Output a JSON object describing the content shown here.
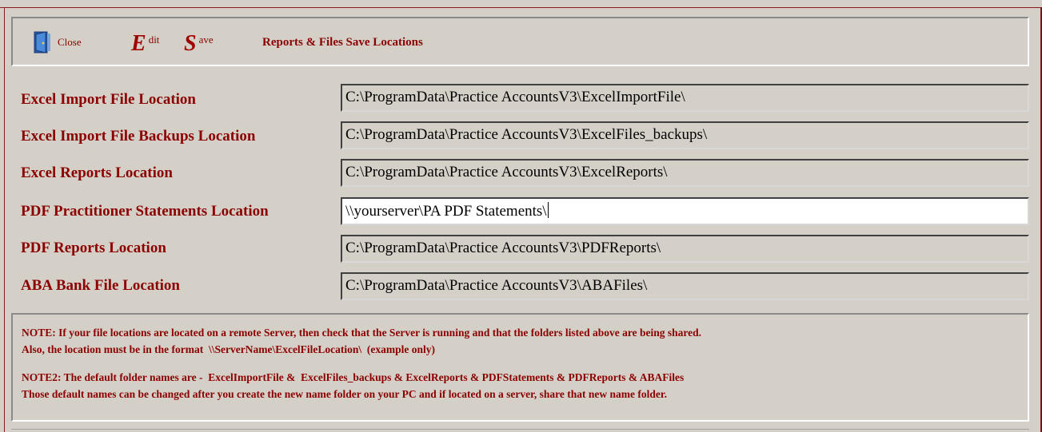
{
  "toolbar": {
    "close_label": "Close",
    "edit_letter": "E",
    "edit_rest": "dit",
    "save_letter": "S",
    "save_rest": "ave",
    "title": "Reports & Files Save Locations"
  },
  "fields": [
    {
      "label": "Excel Import File Location",
      "value": "C:\\ProgramData\\Practice AccountsV3\\ExcelImportFile\\"
    },
    {
      "label": "Excel Import File Backups Location",
      "value": "C:\\ProgramData\\Practice AccountsV3\\ExcelFiles_backups\\"
    },
    {
      "label": "Excel Reports Location",
      "value": "C:\\ProgramData\\Practice AccountsV3\\ExcelReports\\"
    },
    {
      "label": "PDF Practitioner Statements Location",
      "value": "\\\\yourserver\\PA PDF Statements\\"
    },
    {
      "label": "PDF Reports Location",
      "value": "C:\\ProgramData\\Practice AccountsV3\\PDFReports\\"
    },
    {
      "label": "ABA Bank File Location",
      "value": "C:\\ProgramData\\Practice AccountsV3\\ABAFiles\\"
    }
  ],
  "notes": {
    "note1_line1": "NOTE: If your file locations are located on a remote Server, then check that the Server is running and that the folders listed above are being shared.",
    "note1_line2": "Also, the location must be in the format  \\\\ServerName\\ExcelFileLocation\\  (example only)",
    "note2_line1": "NOTE2: The default folder names are -  ExcelImportFile &  ExcelFiles_backups & ExcelReports & PDFStatements & PDFReports & ABAFiles",
    "note2_line2": "Those default names can be changed after you create the new name folder on your PC and if located on a server, share that new name folder."
  },
  "colors": {
    "accent": "#8b0000",
    "background": "#d4d0c8",
    "active_field": "#ffffff"
  },
  "icons": {
    "close": "door-exit-icon"
  }
}
